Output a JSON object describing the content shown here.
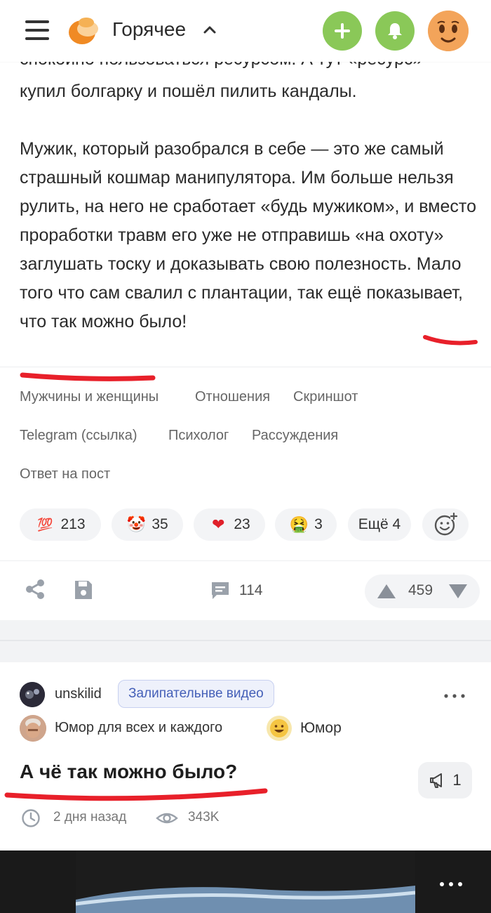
{
  "header": {
    "title": "Горячее"
  },
  "post1": {
    "cut_line": "спокойно пользоваться ресурсом. А тут «ресурс»",
    "paragraphs": [
      "купил болгарку и пошёл пилить кандалы.",
      "Мужик, который разобрался в себе — это же самый страшный кошмар манипулятора. Им больше нельзя рулить, на него не сработает «будь мужиком», и вместо проработки травм его уже не отправишь «на охоту» заглушать тоску и доказывать свою полезность. Мало того что сам свалил с плантации, так ещё показывает, что так можно было!"
    ],
    "tags": [
      "Мужчины и женщины",
      "Отношения",
      "Скриншот",
      "Telegram (ссылка)",
      "Психолог",
      "Рассуждения",
      "Ответ на пост"
    ],
    "reactions": [
      {
        "icon": "hundred-points-icon",
        "glyph": "💯",
        "count": "213"
      },
      {
        "icon": "clown-icon",
        "glyph": "🤡",
        "count": "35"
      },
      {
        "icon": "heart-icon",
        "glyph": "❤",
        "count": "23"
      },
      {
        "icon": "nauseated-face-icon",
        "glyph": "🤮",
        "count": "3"
      }
    ],
    "more_reactions": "Ещё 4",
    "comments_count": "114",
    "rating": "459"
  },
  "post2": {
    "username": "unskilid",
    "badge": "Залипательнве видео",
    "community": "Юмор для всех и каждого",
    "category": "Юмор",
    "title": "А чё так можно было?",
    "replies": "1",
    "time": "2 дня назад",
    "views": "343K"
  },
  "colors": {
    "accent_green": "#8ac858",
    "marker_red": "#e8202a",
    "badge_blue": "#4560b8"
  }
}
